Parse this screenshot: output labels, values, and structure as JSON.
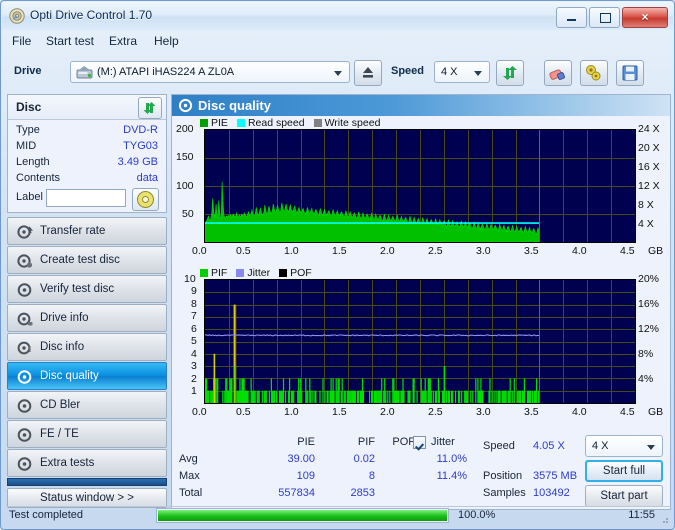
{
  "window": {
    "title": "Opti Drive Control 1.70",
    "icon": "disc-icon",
    "minimize": "minimize-icon",
    "maximize": "maximize-icon",
    "close": "×"
  },
  "menu": [
    "File",
    "Start test",
    "Extra",
    "Help"
  ],
  "toolbar": {
    "drive_label": "Drive",
    "drive_value": "(M:)  ATAPI iHAS224  A ZL0A",
    "eject_icon": "eject-icon",
    "speed_label": "Speed",
    "speed_value": "4 X",
    "refresh_icon": "refresh-icon",
    "erase_icon": "eraser-icon",
    "settings_icon": "settings-icon",
    "save_icon": "save-icon"
  },
  "disc_panel": {
    "title": "Disc",
    "refresh_icon": "refresh-icon",
    "rows": [
      {
        "key": "Type",
        "value": "DVD-R"
      },
      {
        "key": "MID",
        "value": "TYG03"
      },
      {
        "key": "Length",
        "value": "3.49 GB"
      },
      {
        "key": "Contents",
        "value": "data"
      }
    ],
    "label_key": "Label",
    "label_value": "",
    "label_button_icon": "disc-icon"
  },
  "nav": {
    "items": [
      {
        "label": "Transfer rate",
        "icon": "disc-speed-icon",
        "selected": false
      },
      {
        "label": "Create test disc",
        "icon": "disc-burn-icon",
        "selected": false
      },
      {
        "label": "Verify test disc",
        "icon": "disc-check-icon",
        "selected": false
      },
      {
        "label": "Drive info",
        "icon": "drive-info-icon",
        "selected": false
      },
      {
        "label": "Disc info",
        "icon": "disc-info-icon",
        "selected": false
      },
      {
        "label": "Disc quality",
        "icon": "disc-quality-icon",
        "selected": true
      },
      {
        "label": "CD Bler",
        "icon": "disc-bler-icon",
        "selected": false
      },
      {
        "label": "FE / TE",
        "icon": "disc-fete-icon",
        "selected": false
      },
      {
        "label": "Extra tests",
        "icon": "disc-extra-icon",
        "selected": false
      }
    ],
    "status_window_button": "Status window > >"
  },
  "content": {
    "header_title": "Disc quality",
    "header_icon": "disc-quality-icon"
  },
  "stats": {
    "col_headers": [
      "PIE",
      "PIF",
      "POF",
      "Jitter"
    ],
    "jitter_checked": true,
    "rows": [
      {
        "label": "Avg",
        "pie": "39.00",
        "pif": "0.02",
        "pof": "",
        "jitter": "11.0%"
      },
      {
        "label": "Max",
        "pie": "109",
        "pif": "8",
        "pof": "",
        "jitter": "11.4%"
      },
      {
        "label": "Total",
        "pie": "557834",
        "pif": "2853",
        "pof": "",
        "jitter": ""
      }
    ],
    "side": [
      {
        "key": "Speed",
        "value": "4.05 X"
      },
      {
        "key": "Position",
        "value": "3575 MB"
      },
      {
        "key": "Samples",
        "value": "103492"
      }
    ],
    "speed_select": "4 X",
    "start_full": "Start full",
    "start_part": "Start part"
  },
  "statusbar": {
    "text": "Test completed",
    "progress_percent": "100.0%",
    "progress_value": 100,
    "time": "11:55"
  },
  "colors": {
    "plot_bg": "#000050",
    "grid": "#4a4a14",
    "pie_green": "#00a000",
    "read_speed_cyan": "#00ffff",
    "write_speed_gray": "#808080",
    "pif_green": "#00e000",
    "jitter_blue": "#8888ee",
    "pof_black": "#000000",
    "marker_magenta": "#c31fc3",
    "accent_blue": "#2b3ccc"
  },
  "chart_data": [
    {
      "type": "area",
      "title": "PIE / Read speed / Write speed",
      "xlabel": "GB",
      "ylabel": "PIE",
      "xlim": [
        0.0,
        4.5
      ],
      "ylim": [
        0,
        200
      ],
      "y2lim": [
        0,
        24
      ],
      "y2label": "X",
      "xticks": [
        "0.0",
        "0.5",
        "1.0",
        "1.5",
        "2.0",
        "2.5",
        "3.0",
        "3.5",
        "4.0",
        "4.5"
      ],
      "yticks": [
        "200",
        "150",
        "100",
        "50"
      ],
      "y2ticks": [
        "24 X",
        "20 X",
        "16 X",
        "12 X",
        "8 X",
        "4 X"
      ],
      "grid": true,
      "legend": [
        {
          "name": "PIE",
          "color": "#00a000"
        },
        {
          "name": "Read speed",
          "color": "#00ffff"
        },
        {
          "name": "Write speed",
          "color": "#808080"
        }
      ],
      "data_end_gb": 3.5,
      "marker_gb": 3.5,
      "series": [
        {
          "name": "PIE",
          "color": "#00d000",
          "x_start": 0.0,
          "x_end": 3.5,
          "values": [
            34,
            36,
            38,
            42,
            47,
            40,
            38,
            44,
            52,
            78,
            60,
            45,
            50,
            68,
            46,
            42,
            74,
            58,
            44,
            41,
            108,
            76,
            50,
            44,
            42,
            46,
            44,
            48,
            45,
            47,
            49,
            44,
            46,
            50,
            48,
            45,
            47,
            52,
            46,
            44,
            49,
            47,
            45,
            50,
            48,
            46,
            52,
            49,
            47,
            45,
            50,
            54,
            48,
            46,
            52,
            58,
            50,
            48,
            46,
            52,
            62,
            54,
            50,
            48,
            56,
            60,
            52,
            50,
            48,
            54,
            66,
            58,
            52,
            50,
            58,
            64,
            56,
            52,
            50,
            58,
            68,
            60,
            54,
            52,
            60,
            66,
            58,
            54,
            52,
            60,
            70,
            62,
            56,
            54,
            62,
            68,
            60,
            56,
            54,
            62,
            66,
            58,
            56,
            54,
            60,
            64,
            58,
            54,
            52,
            58,
            62,
            56,
            54,
            52,
            58,
            60,
            54,
            52,
            50,
            56,
            62,
            56,
            52,
            50,
            56,
            60,
            54,
            52,
            50,
            56,
            58,
            54,
            50,
            48,
            54,
            60,
            54,
            50,
            48,
            54,
            58,
            52,
            50,
            48,
            54,
            56,
            52,
            48,
            46,
            52,
            58,
            52,
            48,
            46,
            52,
            56,
            50,
            48,
            46,
            52,
            54,
            50,
            46,
            44,
            50,
            56,
            50,
            46,
            44,
            50,
            54,
            48,
            46,
            44,
            50,
            52,
            48,
            44,
            42,
            48,
            54,
            48,
            44,
            42,
            48,
            52,
            46,
            44,
            42,
            48,
            50,
            46,
            42,
            40,
            46,
            52,
            46,
            42,
            40,
            46,
            50,
            44,
            42,
            40,
            46,
            48,
            44,
            40,
            38,
            44,
            50,
            44,
            40,
            38,
            44,
            48,
            42,
            40,
            38,
            44,
            46,
            42,
            38,
            36,
            42,
            48,
            42,
            38,
            36,
            42,
            46,
            40,
            38,
            36,
            42,
            44,
            40,
            36,
            34,
            40,
            46,
            40,
            36,
            34,
            40,
            44,
            38,
            36,
            34,
            40,
            42,
            38,
            34,
            32,
            38,
            44,
            38,
            34,
            32,
            38,
            42,
            36,
            34,
            32,
            38,
            40,
            36,
            32,
            30,
            36,
            42,
            36,
            32,
            30,
            36,
            40,
            34,
            32,
            30,
            36,
            38,
            34,
            30,
            28,
            34,
            40,
            34,
            30,
            28,
            34,
            38,
            32,
            30,
            28,
            34,
            36,
            32,
            28,
            26,
            32,
            38,
            32,
            28,
            26,
            32,
            36,
            30,
            28,
            26,
            32,
            34,
            30,
            26,
            24,
            30,
            36,
            30,
            26,
            24,
            30,
            34,
            28,
            26,
            24,
            30,
            32,
            28,
            24,
            22,
            28,
            34,
            28,
            24,
            22,
            28,
            32,
            26,
            24,
            22,
            28,
            30,
            26,
            22,
            20,
            26,
            32,
            26,
            22,
            20,
            26,
            30,
            24,
            22,
            20,
            26,
            28,
            24,
            20,
            18,
            24,
            30,
            24,
            20,
            18,
            24,
            28,
            22,
            20,
            18,
            24,
            26,
            22,
            18,
            16,
            22,
            28,
            22,
            18,
            16,
            22,
            26,
            20,
            18,
            16,
            22,
            24,
            20,
            16,
            14,
            20,
            26,
            20
          ]
        },
        {
          "name": "Read speed",
          "color": "#00ffff",
          "constant_value_x": 4.05,
          "x_start": 0.0,
          "x_end": 3.5
        }
      ]
    },
    {
      "type": "bar",
      "title": "PIF / Jitter / POF",
      "xlabel": "GB",
      "ylabel": "PIF",
      "xlim": [
        0.0,
        4.5
      ],
      "ylim": [
        0,
        10
      ],
      "y2lim": [
        0,
        20
      ],
      "y2label": "%",
      "xticks": [
        "0.0",
        "0.5",
        "1.0",
        "1.5",
        "2.0",
        "2.5",
        "3.0",
        "3.5",
        "4.0",
        "4.5"
      ],
      "yticks": [
        "10",
        "9",
        "8",
        "7",
        "6",
        "5",
        "4",
        "3",
        "2",
        "1"
      ],
      "y2ticks": [
        "20%",
        "16%",
        "12%",
        "8%",
        "4%"
      ],
      "grid": true,
      "legend": [
        {
          "name": "PIF",
          "color": "#00d000"
        },
        {
          "name": "Jitter",
          "color": "#8888ee"
        },
        {
          "name": "POF",
          "color": "#000000"
        }
      ],
      "data_end_gb": 3.5,
      "marker_gb": 3.5,
      "series": [
        {
          "name": "PIF",
          "color": "#00e000",
          "note": "bars mostly 1-2, spike of 8 near 0.3 GB, spike of 4 near 0.1 GB, spike of 3 near 2.5 GB"
        },
        {
          "name": "Jitter",
          "color": "#8888ee",
          "avg_percent": 11.0,
          "max_percent": 11.4,
          "note": "flat line near 11% across disc"
        }
      ]
    }
  ]
}
